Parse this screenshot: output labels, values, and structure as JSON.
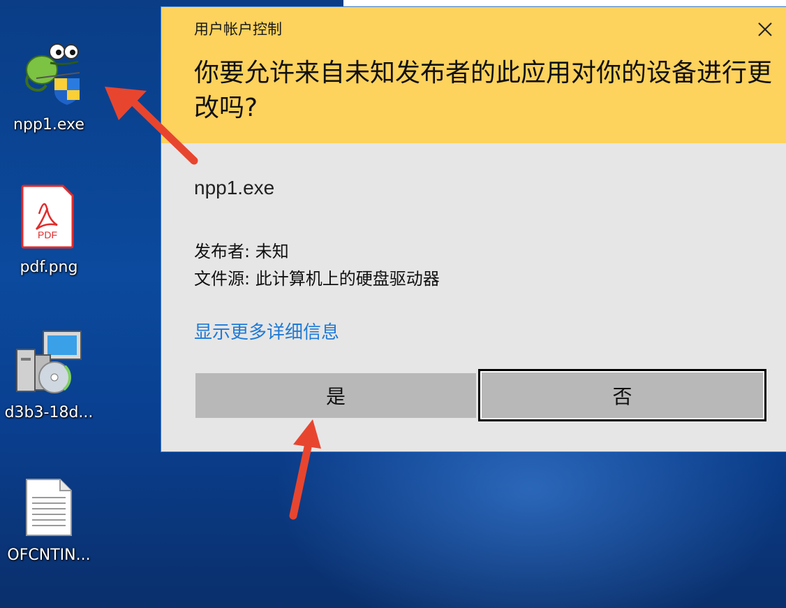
{
  "desktop": {
    "icons": [
      {
        "label": "npp1.exe",
        "icon": "notepadpp-uac-icon"
      },
      {
        "label": "pdf.png",
        "icon": "pdf-file-icon"
      },
      {
        "label": "d3b3-18d...",
        "icon": "installer-icon"
      },
      {
        "label": "OFCNTIN...",
        "icon": "text-file-icon"
      }
    ]
  },
  "dialog": {
    "title": "用户帐户控制",
    "question": "你要允许来自未知发布者的此应用对你的设备进行更改吗?",
    "app_name": "npp1.exe",
    "publisher": "发布者: 未知",
    "file_source": "文件源: 此计算机上的硬盘驱动器",
    "more_details": "显示更多详细信息",
    "yes_label": "是",
    "no_label": "否"
  },
  "colors": {
    "header": "#fdd25d",
    "dialog_bg": "#e6e6e6",
    "link": "#1f7ad6",
    "button": "#b8b8b8",
    "arrow": "#e8452f",
    "desktop": "#0b4a9e"
  }
}
